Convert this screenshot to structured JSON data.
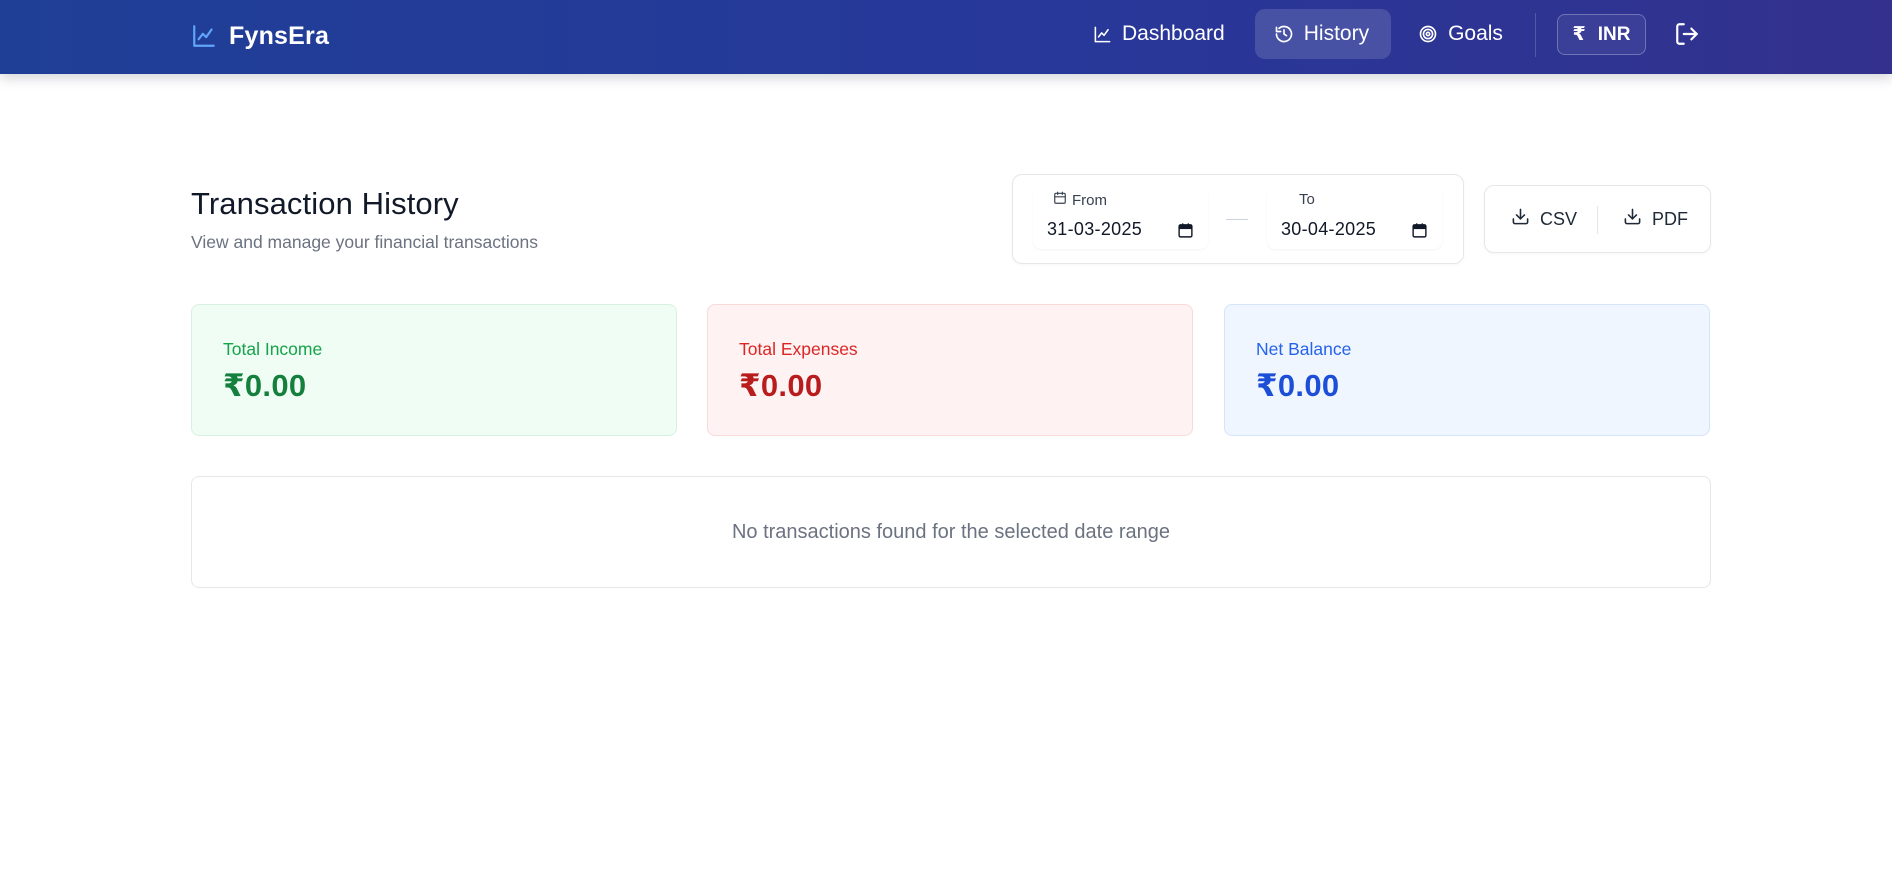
{
  "app": {
    "name": "FynsEra"
  },
  "nav": {
    "items": [
      {
        "label": "Dashboard",
        "active": false
      },
      {
        "label": "History",
        "active": true
      },
      {
        "label": "Goals",
        "active": false
      }
    ],
    "currency_symbol": "₹",
    "currency_code": "INR"
  },
  "page": {
    "title": "Transaction History",
    "subtitle": "View and manage your financial transactions"
  },
  "date_range": {
    "from_label": "From",
    "from_value": "31-03-2025",
    "to_label": "To",
    "to_value": "30-04-2025"
  },
  "export": {
    "csv_label": "CSV",
    "pdf_label": "PDF"
  },
  "summary": {
    "income": {
      "label": "Total Income",
      "value": "₹0.00",
      "color": "#15803d"
    },
    "expenses": {
      "label": "Total Expenses",
      "value": "₹0.00",
      "color": "#b91c1c"
    },
    "balance": {
      "label": "Net Balance",
      "value": "₹0.00",
      "color": "#1d4ed8"
    }
  },
  "transactions": {
    "empty_message": "No transactions found for the selected date range"
  },
  "theme": {
    "header_gradient_start": "#1f3f96",
    "header_gradient_end": "#33318d",
    "accent": "#60a5fa"
  }
}
